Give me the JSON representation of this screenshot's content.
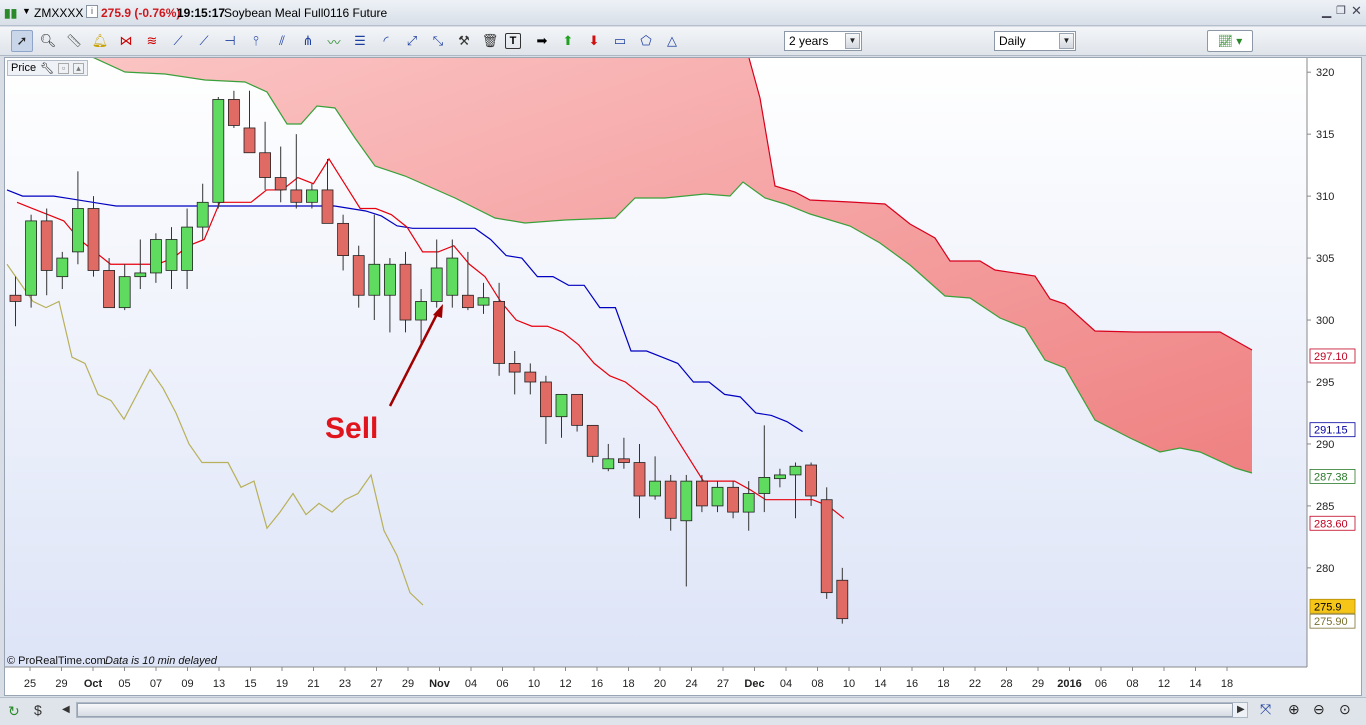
{
  "window": {
    "symbol": "ZMXXXX",
    "change": "275.9 (-0.76%)",
    "time": "19:15:17",
    "instrument_name": "Soybean Meal Full0116 Future"
  },
  "toolbar": {
    "period_select": "2 years",
    "interval_select": "Daily"
  },
  "chart": {
    "price_label": "Price",
    "footer_note": "© ProRealTime.com",
    "delay_note": "Data is 10 min delayed",
    "annotation": "Sell",
    "colors": {
      "up": "#5fdc5f",
      "down": "#e06a64",
      "tenkan": "#e8000d",
      "kijun": "#0000c0",
      "chikou": "#b8b05a",
      "kumo_bear": "#f49a9a",
      "kumo_edge_green": "#3aa03a",
      "arrow": "#a00000"
    }
  },
  "chart_data": {
    "type": "candlestick",
    "y_axis_ticks": [
      "320",
      "315",
      "310",
      "305",
      "300",
      "295",
      "290",
      "285",
      "280"
    ],
    "ylim": [
      272,
      320.5
    ],
    "x_axis_ticks": [
      "25",
      "29",
      "Oct",
      "05",
      "07",
      "09",
      "13",
      "15",
      "19",
      "21",
      "23",
      "27",
      "29",
      "Nov",
      "04",
      "06",
      "10",
      "12",
      "16",
      "18",
      "20",
      "24",
      "27",
      "Dec",
      "04",
      "08",
      "10",
      "14",
      "16",
      "18",
      "22",
      "28",
      "29",
      "2016",
      "06",
      "08",
      "12",
      "14",
      "18"
    ],
    "price_badges": [
      {
        "text": "297.10",
        "color": "#c00020"
      },
      {
        "text": "291.15",
        "color": "#0000a0"
      },
      {
        "text": "287.38",
        "color": "#2a7a2a"
      },
      {
        "text": "283.60",
        "color": "#c00020"
      },
      {
        "text": "275.9",
        "color": "#000000",
        "bg": "#f5c518"
      },
      {
        "text": "275.90",
        "color": "#7a7030"
      }
    ],
    "candles": [
      {
        "o": 302,
        "h": 303.5,
        "l": 299.5,
        "c": 301.5
      },
      {
        "o": 302,
        "h": 308.5,
        "l": 301,
        "c": 308
      },
      {
        "o": 308,
        "h": 309,
        "l": 302,
        "c": 304
      },
      {
        "o": 303.5,
        "h": 305.5,
        "l": 302.5,
        "c": 305
      },
      {
        "o": 305.5,
        "h": 312,
        "l": 304.5,
        "c": 309
      },
      {
        "o": 309,
        "h": 310,
        "l": 303.5,
        "c": 304
      },
      {
        "o": 304,
        "h": 305,
        "l": 301,
        "c": 301
      },
      {
        "o": 301,
        "h": 304.5,
        "l": 300.8,
        "c": 303.5
      },
      {
        "o": 303.5,
        "h": 306.5,
        "l": 302.5,
        "c": 303.8
      },
      {
        "o": 303.8,
        "h": 307,
        "l": 303,
        "c": 306.5
      },
      {
        "o": 304,
        "h": 307.5,
        "l": 302.5,
        "c": 306.5
      },
      {
        "o": 304,
        "h": 309,
        "l": 302.5,
        "c": 307.5
      },
      {
        "o": 307.5,
        "h": 311,
        "l": 306.5,
        "c": 309.5
      },
      {
        "o": 309.5,
        "h": 318,
        "l": 309,
        "c": 317.8
      },
      {
        "o": 317.8,
        "h": 318.5,
        "l": 315.5,
        "c": 315.7
      },
      {
        "o": 315.5,
        "h": 318.5,
        "l": 313.5,
        "c": 313.5
      },
      {
        "o": 313.5,
        "h": 316,
        "l": 310.5,
        "c": 311.5
      },
      {
        "o": 311.5,
        "h": 314,
        "l": 309.5,
        "c": 310.5
      },
      {
        "o": 310.5,
        "h": 315,
        "l": 309,
        "c": 309.5
      },
      {
        "o": 309.5,
        "h": 311,
        "l": 309,
        "c": 310.5
      },
      {
        "o": 310.5,
        "h": 313,
        "l": 307.8,
        "c": 307.8
      },
      {
        "o": 307.8,
        "h": 308.5,
        "l": 304,
        "c": 305.2
      },
      {
        "o": 305.2,
        "h": 306,
        "l": 301,
        "c": 302
      },
      {
        "o": 302,
        "h": 308.5,
        "l": 300,
        "c": 304.5
      },
      {
        "o": 302,
        "h": 305,
        "l": 299,
        "c": 304.5
      },
      {
        "o": 304.5,
        "h": 305.5,
        "l": 299,
        "c": 300
      },
      {
        "o": 300,
        "h": 302.5,
        "l": 298,
        "c": 301.5
      },
      {
        "o": 301.5,
        "h": 306.5,
        "l": 301,
        "c": 304.2
      },
      {
        "o": 302,
        "h": 306.5,
        "l": 301,
        "c": 305
      },
      {
        "o": 302,
        "h": 305.5,
        "l": 300.8,
        "c": 301
      },
      {
        "o": 301.2,
        "h": 303,
        "l": 300.5,
        "c": 301.8
      },
      {
        "o": 301.5,
        "h": 303,
        "l": 295.5,
        "c": 296.5
      },
      {
        "o": 296.5,
        "h": 297.5,
        "l": 294,
        "c": 295.8
      },
      {
        "o": 295.8,
        "h": 296.5,
        "l": 294,
        "c": 295
      },
      {
        "o": 295,
        "h": 295.5,
        "l": 290,
        "c": 292.2
      },
      {
        "o": 292.2,
        "h": 294,
        "l": 290.5,
        "c": 294
      },
      {
        "o": 294,
        "h": 294,
        "l": 291,
        "c": 291.5
      },
      {
        "o": 291.5,
        "h": 291.5,
        "l": 288.5,
        "c": 289
      },
      {
        "o": 288,
        "h": 290,
        "l": 287.8,
        "c": 288.8
      },
      {
        "o": 288.8,
        "h": 290.5,
        "l": 288,
        "c": 288.5
      },
      {
        "o": 288.5,
        "h": 290,
        "l": 284,
        "c": 285.8
      },
      {
        "o": 285.8,
        "h": 289,
        "l": 285.5,
        "c": 287
      },
      {
        "o": 287,
        "h": 287.5,
        "l": 283,
        "c": 284
      },
      {
        "o": 283.8,
        "h": 287.5,
        "l": 278.5,
        "c": 287
      },
      {
        "o": 287,
        "h": 287.5,
        "l": 284.5,
        "c": 285
      },
      {
        "o": 285,
        "h": 287,
        "l": 284.5,
        "c": 286.5
      },
      {
        "o": 286.5,
        "h": 287,
        "l": 284,
        "c": 284.5
      },
      {
        "o": 284.5,
        "h": 287,
        "l": 283,
        "c": 286
      },
      {
        "o": 286,
        "h": 291.5,
        "l": 284.5,
        "c": 287.3
      },
      {
        "o": 287.2,
        "h": 288,
        "l": 286.5,
        "c": 287.5
      },
      {
        "o": 287.5,
        "h": 288.5,
        "l": 284,
        "c": 288.2
      },
      {
        "o": 288.3,
        "h": 288.5,
        "l": 285,
        "c": 285.8
      },
      {
        "o": 285.5,
        "h": 286.5,
        "l": 277.5,
        "c": 278
      },
      {
        "o": 279,
        "h": 280,
        "l": 275.5,
        "c": 275.9
      }
    ],
    "tenkan": [
      309.5,
      309,
      308.5,
      308,
      306.5,
      305.5,
      304.5,
      304.5,
      304.5,
      304.5,
      305,
      306,
      306.5,
      309.5,
      309.5,
      309.5,
      310.5,
      310.5,
      311.5,
      311,
      313,
      311,
      309,
      309,
      308.5,
      307.5,
      305.5,
      305.5,
      306,
      304.5,
      303.5,
      301.5,
      300,
      299.5,
      299.5,
      299,
      298,
      296.5,
      295.5,
      295,
      294,
      293,
      291,
      289,
      287,
      287,
      287,
      286.3,
      285.5,
      285.5,
      285.5,
      285.5,
      285,
      284
    ],
    "kijun": [
      310.5,
      310,
      310,
      310,
      309.8,
      309.6,
      309.4,
      309.2,
      309.2,
      309.2,
      309.2,
      309.2,
      309.2,
      309.2,
      309.2,
      309.2,
      309.2,
      309.2,
      309.2,
      309.2,
      309.2,
      309.2,
      309,
      308.8,
      308.4,
      307.6,
      307.4,
      307.4,
      307.4,
      307.4,
      307.4,
      306.5,
      305.2,
      305,
      303.5,
      303.5,
      302.8,
      302.8,
      301,
      301,
      297.5,
      297.5,
      297,
      296.5,
      295,
      295,
      294,
      293.8,
      292.5,
      292.3,
      291.8,
      291
    ],
    "chikou": [
      304.5,
      303,
      301.5,
      301,
      301.5,
      297,
      296.5,
      294,
      293.5,
      292,
      294,
      296,
      294.5,
      292.5,
      290,
      288.5,
      288.5,
      288.5,
      286.5,
      287,
      283.2,
      284.5,
      286,
      284.3,
      285.2,
      284.5,
      285.5,
      286,
      287.5,
      283,
      281,
      278,
      277
    ]
  }
}
